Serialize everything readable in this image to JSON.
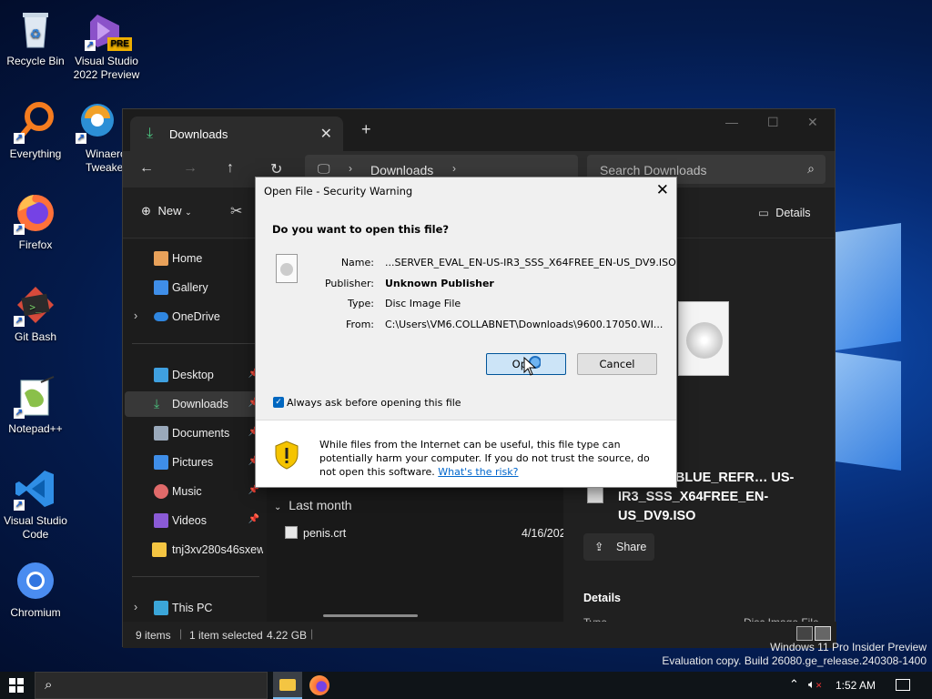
{
  "desktop": {
    "icons": [
      {
        "label": "Recycle Bin",
        "icon": "recycle-bin-icon"
      },
      {
        "label": "Visual Studio 2022 Preview",
        "icon": "visual-studio-preview-icon",
        "badge": "PRE"
      },
      {
        "label": "Everything",
        "icon": "everything-search-icon"
      },
      {
        "label": "Winaero Tweaker",
        "icon": "winaero-tweaker-icon"
      },
      {
        "label": "Firefox",
        "icon": "firefox-icon"
      },
      {
        "label": "Git Bash",
        "icon": "git-bash-icon"
      },
      {
        "label": "Notepad++",
        "icon": "notepadpp-icon"
      },
      {
        "label": "Visual Studio Code",
        "icon": "vscode-icon"
      },
      {
        "label": "Chromium",
        "icon": "chromium-icon"
      }
    ],
    "watermark": {
      "line1": "Windows 11 Pro Insider Preview",
      "line2": "Evaluation copy. Build 26080.ge_release.240308-1400"
    }
  },
  "explorer": {
    "tab_title": "Downloads",
    "address": {
      "segment": "Downloads"
    },
    "search_placeholder": "Search Downloads",
    "toolbar": {
      "new_label": "New",
      "details_label": "Details"
    },
    "sidebar": [
      {
        "label": "Home",
        "icon": "home-icon"
      },
      {
        "label": "Gallery",
        "icon": "gallery-icon"
      },
      {
        "label": "OneDrive",
        "icon": "onedrive-icon"
      },
      {
        "label": "Desktop",
        "icon": "desktop-folder-icon"
      },
      {
        "label": "Downloads",
        "icon": "downloads-folder-icon"
      },
      {
        "label": "Documents",
        "icon": "documents-folder-icon"
      },
      {
        "label": "Pictures",
        "icon": "pictures-folder-icon"
      },
      {
        "label": "Music",
        "icon": "music-folder-icon"
      },
      {
        "label": "Videos",
        "icon": "videos-folder-icon"
      },
      {
        "label": "tnj3xv280s46sxew",
        "icon": "folder-icon"
      },
      {
        "label": "This PC",
        "icon": "this-pc-icon"
      }
    ],
    "file_list": {
      "group_label": "Last month",
      "file_name": "penis.crt",
      "file_date": "4/16/202"
    },
    "details_pane": {
      "file_title": "…50.WINBLUE_REFR… US-IR3_SSS_X64FREE_EN-US_DV9.ISO",
      "share_label": "Share",
      "section_label": "Details",
      "type_label": "Type",
      "type_value": "Disc Image File"
    },
    "status": {
      "items": "9 items",
      "selected": "1 item selected",
      "size": "4.22 GB"
    }
  },
  "dialog": {
    "title": "Open File - Security Warning",
    "question": "Do you want to open this file?",
    "fields": {
      "name_label": "Name:",
      "name_value": "...SERVER_EVAL_EN-US-IR3_SSS_X64FREE_EN-US_DV9.ISO",
      "publisher_label": "Publisher:",
      "publisher_value": "Unknown Publisher",
      "type_label": "Type:",
      "type_value": "Disc Image File",
      "from_label": "From:",
      "from_value": "C:\\Users\\VM6.COLLABNET\\Downloads\\9600.17050.WI..."
    },
    "open_label": "Open",
    "cancel_label": "Cancel",
    "always_ask_label": "Always ask before opening this file",
    "always_ask_checked": true,
    "warning_text": "While files from the Internet can be useful, this file type can potentially harm your computer. If you do not trust the source, do not open this software.",
    "risk_link": "What's the risk?"
  },
  "taskbar": {
    "clock": "1:52 AM"
  },
  "colors": {
    "accent": "#0067c0",
    "downloads_green": "#4cc37f",
    "shield_yellow": "#f5c400"
  }
}
